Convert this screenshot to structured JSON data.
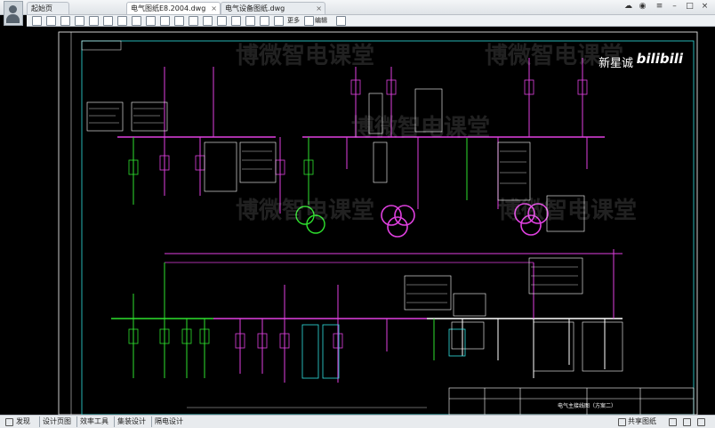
{
  "tabs": [
    {
      "label": "起始页"
    },
    {
      "label": "电气图纸E8.2004.dwg"
    },
    {
      "label": "电气设备图纸.dwg"
    }
  ],
  "toolbar": {
    "more_label": "更多",
    "edit_label": "编辑"
  },
  "watermarks": {
    "brand": "博微智电课堂",
    "user": "新星诚",
    "logo": "bilibili"
  },
  "drawing": {
    "title_block": "电气主接线图（方案二）"
  },
  "status": {
    "tabs": [
      "发现",
      "设计页图",
      "效率工具",
      "集装设计",
      "隔电设计"
    ],
    "right_label": "共享图纸"
  },
  "colors": {
    "magenta": "#e040e0",
    "green": "#2ee02e",
    "cyan": "#30e0e0",
    "white": "#ffffff"
  }
}
